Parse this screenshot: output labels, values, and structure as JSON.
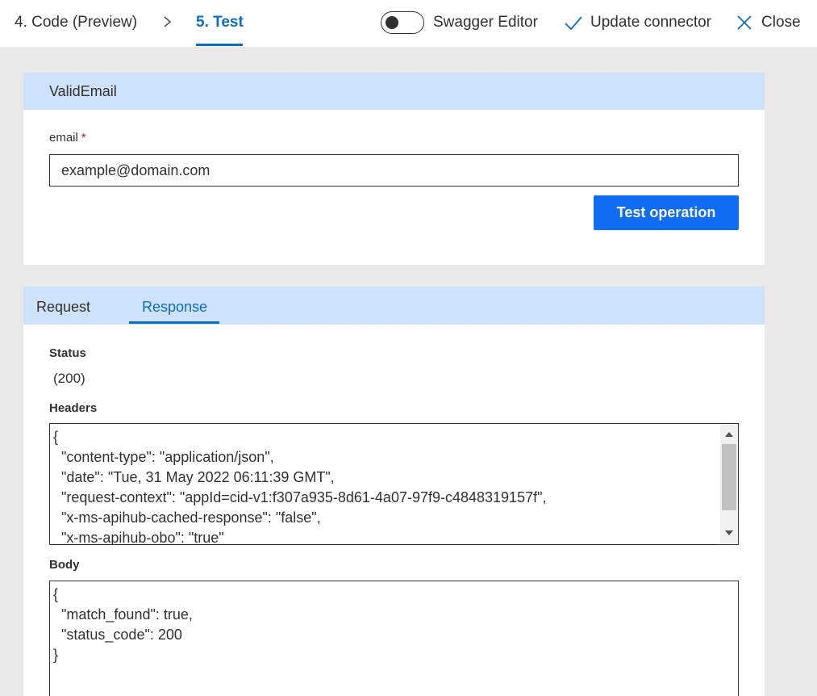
{
  "header": {
    "prev_step": "4. Code (Preview)",
    "current_step": "5. Test",
    "swagger_label": "Swagger Editor",
    "swagger_enabled": false,
    "update_label": "Update connector",
    "close_label": "Close"
  },
  "operation": {
    "title": "ValidEmail",
    "email_label": "email",
    "required_marker": "*",
    "email_value": "example@domain.com",
    "test_button": "Test operation"
  },
  "result": {
    "tabs": [
      {
        "label": "Request",
        "active": false
      },
      {
        "label": "Response",
        "active": true
      }
    ],
    "status_label": "Status",
    "status_value": " (200)",
    "headers_label": "Headers",
    "headers_lines": [
      "{",
      "  \"content-type\": \"application/json\",",
      "  \"date\": \"Tue, 31 May 2022 06:11:39 GMT\",",
      "  \"request-context\": \"appId=cid-v1:f307a935-8d61-4a07-97f9-c4848319157f\",",
      "  \"x-ms-apihub-cached-response\": \"false\",",
      "  \"x-ms-apihub-obo\": \"true\""
    ],
    "body_label": "Body",
    "body_lines": [
      "{",
      "  \"match_found\": true,",
      "  \"status_code\": 200",
      "}"
    ]
  },
  "colors": {
    "accent": "#0f6cbd",
    "button": "#0f6cf3",
    "header_band": "#cfe2fb",
    "background": "#e9e9e9"
  }
}
